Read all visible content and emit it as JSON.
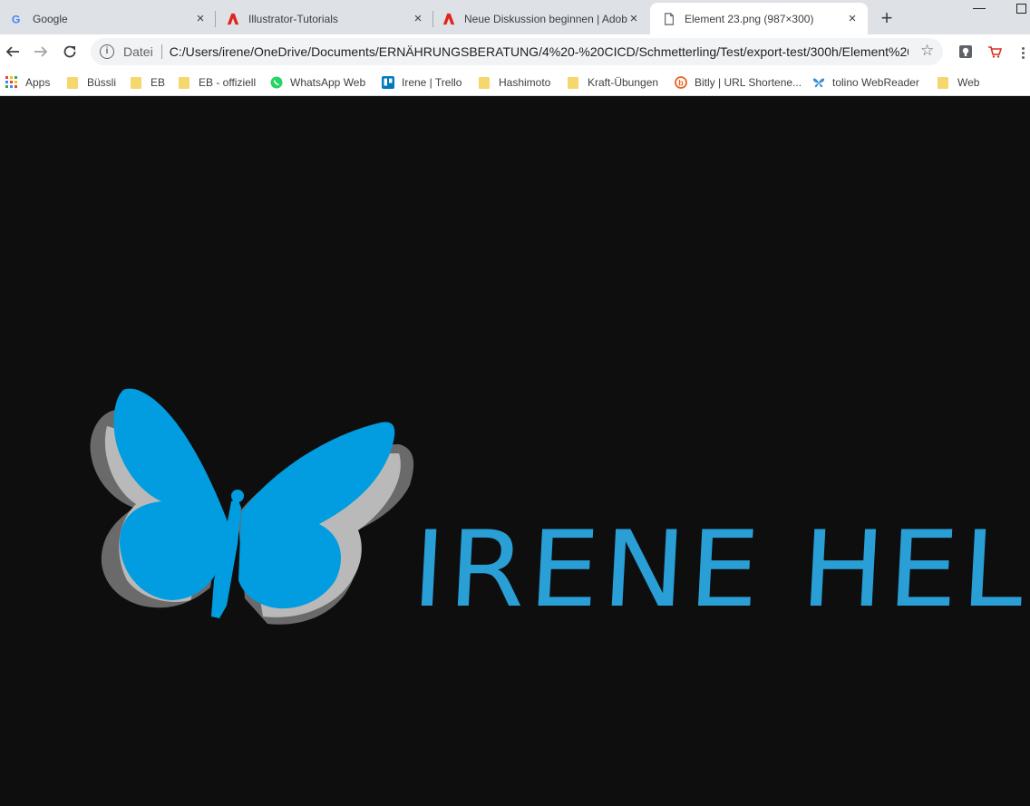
{
  "tabs": [
    {
      "title": "Google",
      "icon": "google-icon"
    },
    {
      "title": "Illustrator-Tutorials",
      "icon": "adobe-icon"
    },
    {
      "title": "Neue Diskussion beginnen | Adobe",
      "icon": "adobe-icon"
    },
    {
      "title": "Element 23.png (987×300)",
      "icon": "file-icon",
      "active": true
    }
  ],
  "omnibox": {
    "security_label": "Datei",
    "url": "C:/Users/irene/OneDrive/Documents/ERNÄHRUNGSBERATUNG/4%20-%20CICD/Schmetterling/Test/export-test/300h/Element%20..."
  },
  "bookmarks": [
    {
      "label": "Apps",
      "icon": "apps-grid-icon"
    },
    {
      "label": "Büssli",
      "icon": "folder-icon"
    },
    {
      "label": "EB",
      "icon": "folder-icon"
    },
    {
      "label": "EB - offiziell",
      "icon": "folder-icon"
    },
    {
      "label": "WhatsApp Web",
      "icon": "whatsapp-icon"
    },
    {
      "label": "Irene | Trello",
      "icon": "trello-icon"
    },
    {
      "label": "Hashimoto",
      "icon": "folder-icon"
    },
    {
      "label": "Kraft-Übungen",
      "icon": "folder-icon"
    },
    {
      "label": "Bitly | URL Shortene...",
      "icon": "bitly-icon"
    },
    {
      "label": "tolino WebReader",
      "icon": "butterfly-icon"
    },
    {
      "label": "Web",
      "icon": "folder-icon"
    }
  ],
  "image": {
    "brand_text": "IRENE HELD"
  },
  "colors": {
    "brand_blue": "#2a9fd6",
    "butterfly_blue": "#019de0",
    "background": "#0e0e0e"
  }
}
